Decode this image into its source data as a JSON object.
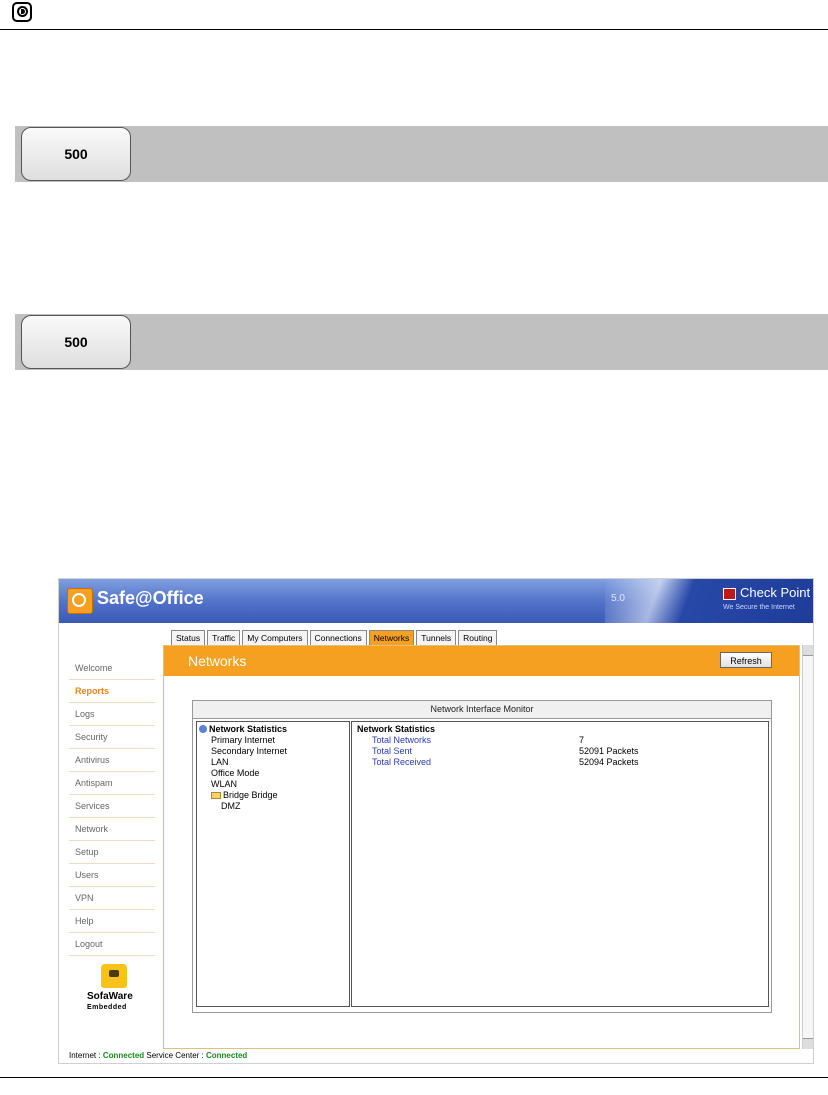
{
  "model_badges": [
    "500",
    "500"
  ],
  "app": {
    "brand": "Safe@Office",
    "version": "5.0",
    "vendor": "Check Point",
    "vendor_tagline": "We Secure the Internet"
  },
  "sidebar": {
    "items": [
      "Welcome",
      "Reports",
      "Logs",
      "Security",
      "Antivirus",
      "Antispam",
      "Services",
      "Network",
      "Setup",
      "Users",
      "VPN",
      "Help",
      "Logout"
    ],
    "active": "Reports",
    "footer_logo_name": "SofaWare",
    "footer_logo_tag": "Embedded"
  },
  "tabs": {
    "items": [
      "Status",
      "Traffic",
      "My Computers",
      "Connections",
      "Networks",
      "Tunnels",
      "Routing"
    ],
    "active": "Networks"
  },
  "page": {
    "title": "Networks",
    "refresh_label": "Refresh"
  },
  "monitor": {
    "title": "Network Interface Monitor",
    "tree": {
      "root": "Network Statistics",
      "items": [
        "Primary Internet",
        "Secondary Internet",
        "LAN",
        "Office Mode",
        "WLAN",
        "Bridge Bridge",
        "DMZ"
      ]
    },
    "details": {
      "title": "Network Statistics",
      "rows": [
        {
          "label": "Total Networks",
          "value": "7"
        },
        {
          "label": "Total Sent",
          "value": "52091 Packets"
        },
        {
          "label": "Total Received",
          "value": "52094 Packets"
        }
      ]
    }
  },
  "status_bar": {
    "internet_label": "Internet :",
    "internet_status": "Connected",
    "service_label": "Service Center :",
    "service_status": "Connected"
  },
  "colors": {
    "accent_orange": "#f5a020",
    "header_blue": "#4a6ac6",
    "connected_green": "#1a8a1a"
  }
}
